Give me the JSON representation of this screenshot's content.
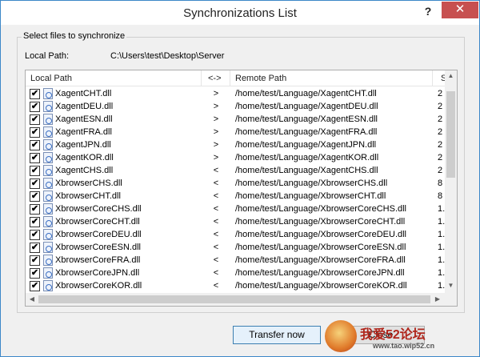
{
  "window": {
    "title": "Synchronizations List",
    "help_label": "?",
    "close_label": "✕"
  },
  "group": {
    "caption": "Select files to synchronize",
    "local_path_label": "Local Path:",
    "local_path_value": "C:\\Users\\test\\Desktop\\Server"
  },
  "table": {
    "columns": [
      "Local Path",
      "<->",
      "Remote Path",
      "S"
    ],
    "rows": [
      {
        "checked": true,
        "name": "XagentCHT.dll",
        "dir": ">",
        "remote": "/home/test/Language/XagentCHT.dll",
        "size": "2"
      },
      {
        "checked": true,
        "name": "XagentDEU.dll",
        "dir": ">",
        "remote": "/home/test/Language/XagentDEU.dll",
        "size": "2"
      },
      {
        "checked": true,
        "name": "XagentESN.dll",
        "dir": ">",
        "remote": "/home/test/Language/XagentESN.dll",
        "size": "2"
      },
      {
        "checked": true,
        "name": "XagentFRA.dll",
        "dir": ">",
        "remote": "/home/test/Language/XagentFRA.dll",
        "size": "2"
      },
      {
        "checked": true,
        "name": "XagentJPN.dll",
        "dir": ">",
        "remote": "/home/test/Language/XagentJPN.dll",
        "size": "2"
      },
      {
        "checked": true,
        "name": "XagentKOR.dll",
        "dir": ">",
        "remote": "/home/test/Language/XagentKOR.dll",
        "size": "2"
      },
      {
        "checked": true,
        "name": "XagentCHS.dll",
        "dir": "<",
        "remote": "/home/test/Language/XagentCHS.dll",
        "size": "2"
      },
      {
        "checked": true,
        "name": "XbrowserCHS.dll",
        "dir": "<",
        "remote": "/home/test/Language/XbrowserCHS.dll",
        "size": "8"
      },
      {
        "checked": true,
        "name": "XbrowserCHT.dll",
        "dir": "<",
        "remote": "/home/test/Language/XbrowserCHT.dll",
        "size": "8"
      },
      {
        "checked": true,
        "name": "XbrowserCoreCHS.dll",
        "dir": "<",
        "remote": "/home/test/Language/XbrowserCoreCHS.dll",
        "size": "1."
      },
      {
        "checked": true,
        "name": "XbrowserCoreCHT.dll",
        "dir": "<",
        "remote": "/home/test/Language/XbrowserCoreCHT.dll",
        "size": "1."
      },
      {
        "checked": true,
        "name": "XbrowserCoreDEU.dll",
        "dir": "<",
        "remote": "/home/test/Language/XbrowserCoreDEU.dll",
        "size": "1."
      },
      {
        "checked": true,
        "name": "XbrowserCoreESN.dll",
        "dir": "<",
        "remote": "/home/test/Language/XbrowserCoreESN.dll",
        "size": "1."
      },
      {
        "checked": true,
        "name": "XbrowserCoreFRA.dll",
        "dir": "<",
        "remote": "/home/test/Language/XbrowserCoreFRA.dll",
        "size": "1."
      },
      {
        "checked": true,
        "name": "XbrowserCoreJPN.dll",
        "dir": "<",
        "remote": "/home/test/Language/XbrowserCoreJPN.dll",
        "size": "1."
      },
      {
        "checked": true,
        "name": "XbrowserCoreKOR.dll",
        "dir": "<",
        "remote": "/home/test/Language/XbrowserCoreKOR.dll",
        "size": "1."
      }
    ]
  },
  "buttons": {
    "transfer": "Transfer now",
    "close": "Close"
  },
  "icons": {
    "file": "dll-file-icon",
    "checkbox_mark": "✔",
    "arrow_up": "▲",
    "arrow_down": "▼",
    "arrow_left": "◀",
    "arrow_right": "▶"
  },
  "watermark": {
    "text": "我爱52论坛",
    "url": "www.tao.wip52.cn"
  },
  "colors": {
    "accent": "#3c87c8",
    "close_button": "#c75050"
  }
}
